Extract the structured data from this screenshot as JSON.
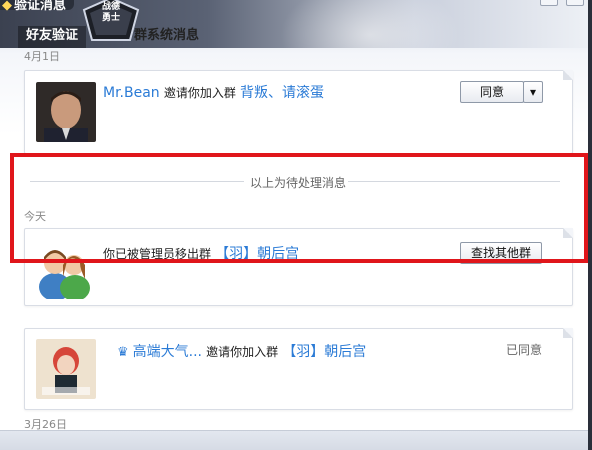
{
  "window": {
    "title": "验证消息"
  },
  "tabs": [
    {
      "label": "好友验证"
    },
    {
      "label": "群系统消息"
    }
  ],
  "badge": {
    "text_top": "战德",
    "text_bottom": "勇士"
  },
  "sections": {
    "pending_date": "4月1日",
    "pending_divider": "以上为待处理消息",
    "today_label": "今天",
    "bottom_date": "3月26日"
  },
  "messages": [
    {
      "sender": "Mr.Bean",
      "action": "邀请你加入群",
      "group": "背叛、请滚蛋",
      "button": "同意",
      "has_dropdown": true
    },
    {
      "action": "你已被管理员移出群",
      "group": "【羽】朝后宫",
      "button": "查找其他群"
    },
    {
      "sender": "高端大气...",
      "action": "邀请你加入群",
      "group": "【羽】朝后宫",
      "status": "已同意",
      "crown_icon": "crown-icon"
    }
  ],
  "colors": {
    "link": "#2b7bd6",
    "highlight": "#e0161b"
  }
}
